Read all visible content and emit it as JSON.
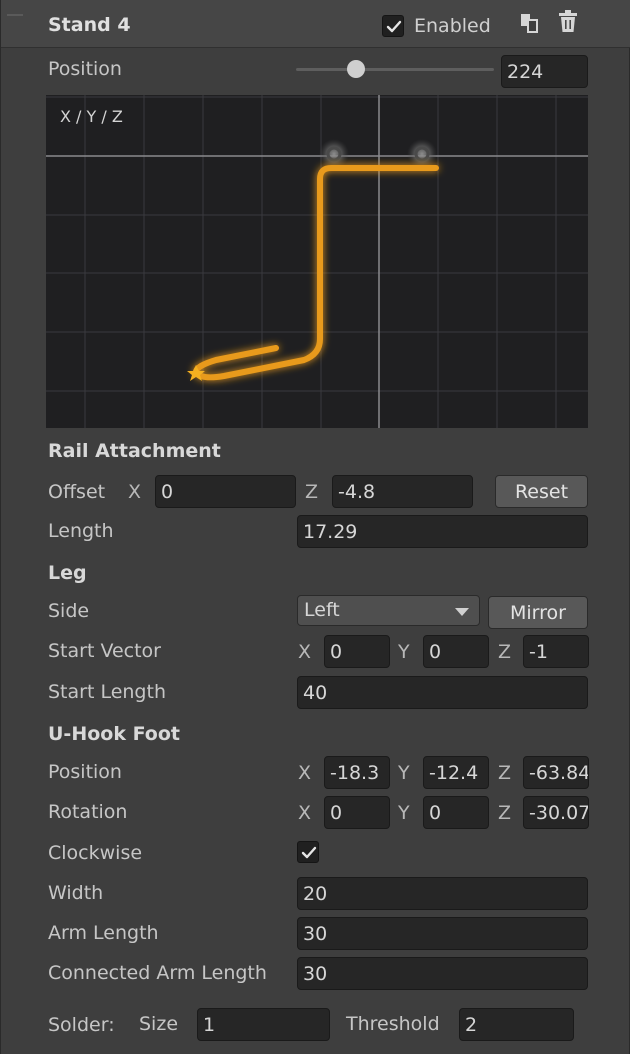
{
  "header": {
    "title": "Stand 4",
    "enabled_label": "Enabled",
    "enabled_checked": true
  },
  "position_row": {
    "label": "Position",
    "slider_value": 224,
    "value": "224"
  },
  "viewport": {
    "label": "X / Y / Z"
  },
  "rail_attachment": {
    "section": "Rail Attachment",
    "offset_label": "Offset",
    "offset_x_axis": "X",
    "offset_x": "0",
    "offset_z_axis": "Z",
    "offset_z": "-4.8",
    "reset_label": "Reset",
    "length_label": "Length",
    "length": "17.29"
  },
  "leg": {
    "section": "Leg",
    "side_label": "Side",
    "side_value": "Left",
    "mirror_label": "Mirror",
    "start_vector_label": "Start Vector",
    "sv_x_axis": "X",
    "sv_x": "0",
    "sv_y_axis": "Y",
    "sv_y": "0",
    "sv_z_axis": "Z",
    "sv_z": "-1",
    "start_length_label": "Start Length",
    "start_length": "40"
  },
  "uhook": {
    "section": "U-Hook Foot",
    "position_label": "Position",
    "pos_x_axis": "X",
    "pos_x": "-18.3",
    "pos_y_axis": "Y",
    "pos_y": "-12.4",
    "pos_z_axis": "Z",
    "pos_z": "-63.84",
    "rotation_label": "Rotation",
    "rot_x_axis": "X",
    "rot_x": "0",
    "rot_y_axis": "Y",
    "rot_y": "0",
    "rot_z_axis": "Z",
    "rot_z": "-30.07",
    "clockwise_label": "Clockwise",
    "clockwise_checked": true,
    "width_label": "Width",
    "width": "20",
    "arm_length_label": "Arm Length",
    "arm_length": "30",
    "connected_arm_length_label": "Connected Arm Length",
    "connected_arm_length": "30"
  },
  "solder": {
    "label": "Solder:",
    "size_label": "Size",
    "size": "1",
    "threshold_label": "Threshold",
    "threshold": "2"
  },
  "colors": {
    "accent_path": "#f0a020",
    "panel_bg": "#3e3e3e",
    "field_bg": "#262626"
  },
  "icons": [
    "checkmark-icon",
    "copy-icon",
    "trash-icon",
    "dropdown-arrow-icon",
    "handle-icon"
  ]
}
